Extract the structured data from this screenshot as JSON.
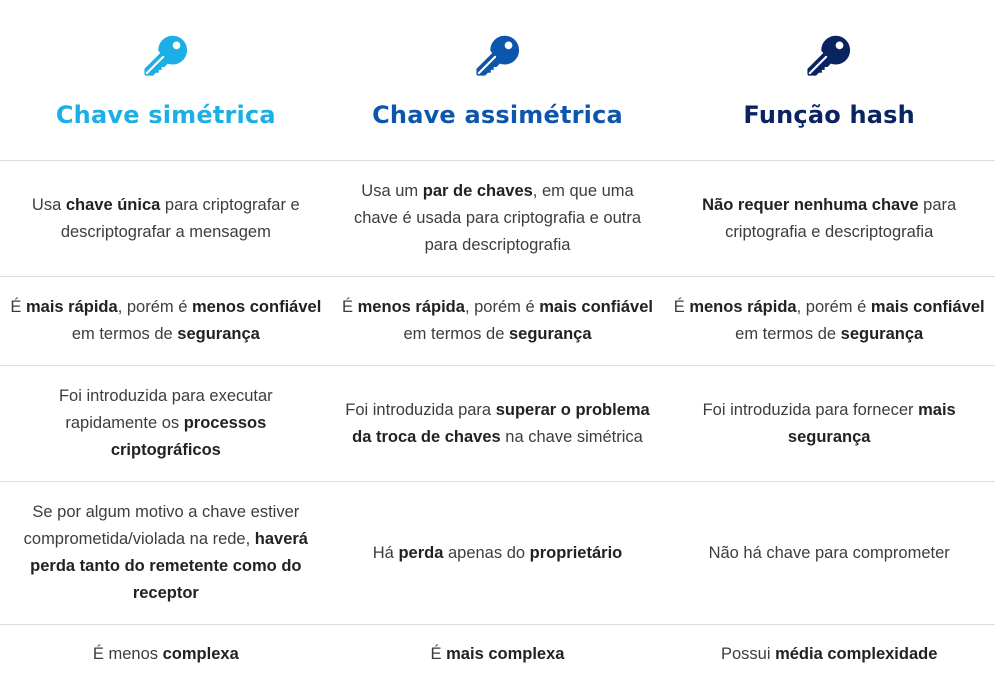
{
  "colors": {
    "symmetric": "#1aafe6",
    "asymmetric": "#0d56ad",
    "hash": "#0a2461",
    "divider": "#dedede",
    "text": "#3d3d3d"
  },
  "columns": [
    {
      "icon": "key-icon",
      "title": "Chave simétrica"
    },
    {
      "icon": "key-icon",
      "title": "Chave assimétrica"
    },
    {
      "icon": "key-icon",
      "title": "Função hash"
    }
  ],
  "rows": [
    [
      [
        {
          "t": "Usa "
        },
        {
          "t": "chave única",
          "b": true
        },
        {
          "t": " para criptografar e descriptografar a mensagem"
        }
      ],
      [
        {
          "t": "Usa um "
        },
        {
          "t": "par de chaves",
          "b": true
        },
        {
          "t": ", em que uma chave é usada para criptografia e outra para descriptografia"
        }
      ],
      [
        {
          "t": "Não requer nenhuma chave",
          "b": true
        },
        {
          "t": " para criptografia e descriptografia"
        }
      ]
    ],
    [
      [
        {
          "t": "É "
        },
        {
          "t": "mais rápida",
          "b": true
        },
        {
          "t": ", porém é "
        },
        {
          "t": "menos confiável",
          "b": true
        },
        {
          "t": " em termos de "
        },
        {
          "t": "segurança",
          "b": true
        }
      ],
      [
        {
          "t": "É "
        },
        {
          "t": "menos rápida",
          "b": true
        },
        {
          "t": ", porém é "
        },
        {
          "t": "mais confiável",
          "b": true
        },
        {
          "t": " em termos de "
        },
        {
          "t": "segurança",
          "b": true
        }
      ],
      [
        {
          "t": "É "
        },
        {
          "t": "menos rápida",
          "b": true
        },
        {
          "t": ", porém é "
        },
        {
          "t": "mais confiável",
          "b": true
        },
        {
          "t": " em termos de "
        },
        {
          "t": "segurança",
          "b": true
        }
      ]
    ],
    [
      [
        {
          "t": "Foi introduzida para executar rapidamente os "
        },
        {
          "t": "processos criptográficos",
          "b": true
        }
      ],
      [
        {
          "t": "Foi introduzida para "
        },
        {
          "t": "superar o problema da troca de chaves",
          "b": true
        },
        {
          "t": " na chave simétrica"
        }
      ],
      [
        {
          "t": "Foi introduzida para fornecer "
        },
        {
          "t": "mais segurança",
          "b": true
        }
      ]
    ],
    [
      [
        {
          "t": "Se por algum motivo a chave estiver comprometida/violada na rede, "
        },
        {
          "t": "haverá perda tanto do remetente como do receptor",
          "b": true
        }
      ],
      [
        {
          "t": "Há "
        },
        {
          "t": "perda",
          "b": true
        },
        {
          "t": " apenas do "
        },
        {
          "t": "proprietário",
          "b": true
        }
      ],
      [
        {
          "t": "Não há chave para comprometer"
        }
      ]
    ],
    [
      [
        {
          "t": "É menos "
        },
        {
          "t": "complexa",
          "b": true
        }
      ],
      [
        {
          "t": "É "
        },
        {
          "t": "mais complexa",
          "b": true
        }
      ],
      [
        {
          "t": "Possui "
        },
        {
          "t": "média complexidade",
          "b": true
        }
      ]
    ]
  ]
}
